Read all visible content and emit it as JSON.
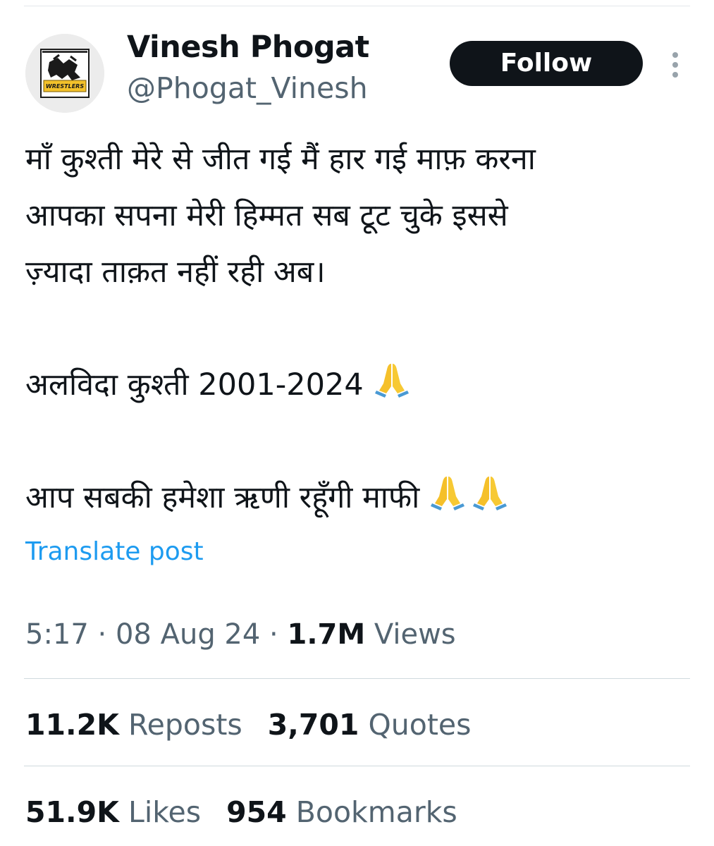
{
  "author": {
    "display_name": "Vinesh Phogat",
    "handle": "@Phogat_Vinesh",
    "avatar_text": "WRESTLERS"
  },
  "follow_label": "Follow",
  "post": {
    "lines": [
      "माँ कुश्ती मेरे से जीत गई मैं हार गई माफ़ करना",
      "आपका सपना मेरी हिम्मत सब टूट चुके इससे",
      "ज़्यादा ताक़त नहीं रही अब।",
      "अलविदा कुश्ती 2001-2024",
      "आप सबकी हमेशा ऋणी रहूँगी माफी"
    ],
    "emojis": [
      "folded-hands",
      "folded-hands",
      "folded-hands"
    ]
  },
  "translate_label": "Translate post",
  "meta": {
    "time": "5:17",
    "separator": " · ",
    "date": "08 Aug 24",
    "views_count": "1.7M",
    "views_label": "Views"
  },
  "stats": {
    "reposts_count": "11.2K",
    "reposts_label": "Reposts",
    "quotes_count": "3,701",
    "quotes_label": "Quotes",
    "likes_count": "51.9K",
    "likes_label": "Likes",
    "bookmarks_count": "954",
    "bookmarks_label": "Bookmarks"
  },
  "colors": {
    "text": "#0f1419",
    "secondary": "#536471",
    "link": "#1d9bf0",
    "button": "#0f1419",
    "divider": "#cfd9de"
  }
}
